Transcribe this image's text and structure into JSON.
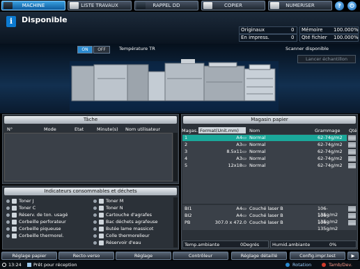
{
  "tabs": [
    {
      "label": "MACHINE"
    },
    {
      "label": "LISTE TRAVAUX"
    },
    {
      "label": "RAPPEL DD"
    },
    {
      "label": "COPIER"
    },
    {
      "label": "NUMERISER"
    }
  ],
  "help_glyph": "?",
  "power_glyph": "⏻",
  "status": {
    "icon": "i",
    "title": "Disponible"
  },
  "counters": {
    "originaux_label": "Originaux",
    "originaux_value": "0",
    "en_impress_label": "En impress.",
    "en_impress_value": "0",
    "memoire_label": "Mémoire",
    "memoire_value": "100.000%",
    "qte_fichier_label": "Qté fichier",
    "qte_fichier_value": "100.000%"
  },
  "machine": {
    "toggle_on": "ON",
    "toggle_off": "OFF",
    "temp_tr": "Température TR",
    "scanner": "Scanner disponible",
    "lancer": "Lancer échantillon"
  },
  "tache": {
    "title": "Tâche",
    "headers": [
      "N°",
      "Mode",
      "Etat",
      "Minute(s)",
      "Nom utilisateur"
    ]
  },
  "consommables": {
    "title": "Indicateurs consommables et déchets",
    "left": [
      "Toner J",
      "Toner C",
      "Réserv. de ton. usagé",
      "Corbeille perforateur",
      "Corbeille piqueuse",
      "Corbeille thermorel."
    ],
    "right": [
      "Toner M",
      "Toner N",
      "Cartouche d'agrafes",
      "Bac déchets agrafeuse",
      "Butée lame massicot",
      "Colle thermorelieur",
      "Réservoir d'eau"
    ]
  },
  "magasin": {
    "title": "Magasin papier",
    "headers": [
      "Magas.",
      "Format(Unit.mm)",
      "Nom",
      "Grammage",
      "Qté"
    ],
    "rows": [
      {
        "tray": "1",
        "format": "A4▭",
        "name": "Normal",
        "weight": "62-74g/m2",
        "selected": true
      },
      {
        "tray": "2",
        "format": "A3▭",
        "name": "Normal",
        "weight": "62-74g/m2"
      },
      {
        "tray": "3",
        "format": "8.5x11▭",
        "name": "Normal",
        "weight": "62-74g/m2"
      },
      {
        "tray": "4",
        "format": "A3▭",
        "name": "Normal",
        "weight": "62-74g/m2"
      },
      {
        "tray": "5",
        "format": "12x18▭",
        "name": "Normal",
        "weight": "62-74g/m2"
      }
    ],
    "rows2": [
      {
        "tray": "BI1",
        "format": "A4▭",
        "name": "Couché laser B",
        "weight": "106-135g/m2"
      },
      {
        "tray": "BI2",
        "format": "A4▭",
        "name": "Couché laser B",
        "weight": "106-135g/m2"
      },
      {
        "tray": "PB",
        "format": "307.0 x 472.0",
        "name": "Couché laser B",
        "weight": "106-135g/m2"
      }
    ],
    "temp_label": "Temp.ambiante",
    "temp_value": "0Degrés",
    "humid_label": "Humid.ambiante",
    "humid_value": "0%"
  },
  "bottom": [
    "Réglage papier",
    "Recto-verso",
    "Réglage",
    "Contrôleur",
    "Réglage détaillé",
    "Config.impr.test"
  ],
  "statusbar": {
    "time": "13:24",
    "message": "Prêt pour réception",
    "rotation": "Rotation",
    "tambdev": "Tamb/Dev."
  },
  "accent": "#0c7ad0",
  "selected_row_color": "#1aa89a"
}
